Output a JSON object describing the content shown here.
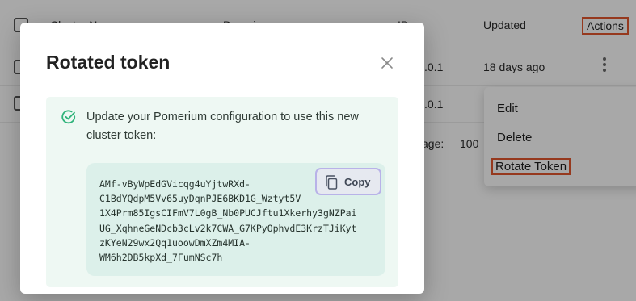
{
  "table": {
    "headers": {
      "cluster_name": "Cluster Name",
      "domain": "Domain",
      "ip": "IP",
      "updated": "Updated",
      "actions": "Actions"
    },
    "rows": [
      {
        "ip_suffix": ".0.1",
        "updated": "18 days ago"
      },
      {
        "ip_suffix": ".0.1",
        "updated": ""
      }
    ],
    "pager": {
      "label": "age:",
      "value": "100"
    }
  },
  "menu": {
    "items": [
      "Edit",
      "Delete",
      "Rotate Token"
    ]
  },
  "modal": {
    "title": "Rotated token",
    "message": "Update your Pomerium configuration to use this new cluster token:",
    "token": "AMf-vByWpEdGVicqg4uYjtwRXd-\nC1BdYQdpM5Vv65uyDqnPJE6BKD1G_Wztyt5V\n1X4Prm85IgsCIFmV7L0gB_Nb0PUCJftu1Xkerhy3gNZPai\nUG_XqhneGeNDcb3cLv2k7CWA_G7KPyOphvdE3KrzTJiKyt\nzKYeN29wx2Qq1uoowDmXZm4MIA-\nWM6h2DB5kpXd_7FumNSc7h",
    "copy_label": "Copy"
  },
  "colors": {
    "alert_bg": "#eef8f3",
    "token_bg": "#dcf0ea",
    "success_green": "#2fb37a",
    "highlight": "#e4572e"
  },
  "icons": {
    "close": "close-icon",
    "check": "check-circle-icon",
    "copy": "copy-icon",
    "kebab": "kebab-menu-icon"
  }
}
